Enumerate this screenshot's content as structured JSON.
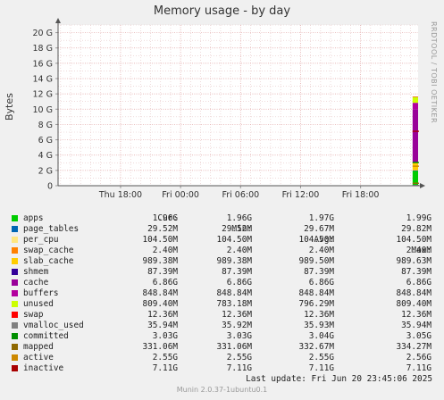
{
  "title": "Memory usage - by day",
  "side_text": "RRDTOOL / TOBI OETIKER",
  "last_update": "Last update: Fri Jun 20 23:45:06 2025",
  "footer": "Munin 2.0.37-1ubuntu0.1",
  "legend_headers": {
    "cur": "Cur:",
    "min": "Min:",
    "avg": "Avg:",
    "max": "Max:"
  },
  "legend": [
    {
      "name": "apps",
      "color": "#00cc00",
      "cur": "1.96G",
      "min": "1.96G",
      "avg": "1.97G",
      "max": "1.99G"
    },
    {
      "name": "page_tables",
      "color": "#0066b3",
      "cur": "29.52M",
      "min": "29.52M",
      "avg": "29.67M",
      "max": "29.82M"
    },
    {
      "name": "per_cpu",
      "color": "#ffe680",
      "cur": "104.50M",
      "min": "104.50M",
      "avg": "104.50M",
      "max": "104.50M"
    },
    {
      "name": "swap_cache",
      "color": "#ff8000",
      "cur": "2.40M",
      "min": "2.40M",
      "avg": "2.40M",
      "max": "2.40M"
    },
    {
      "name": "slab_cache",
      "color": "#ffcc00",
      "cur": "989.38M",
      "min": "989.38M",
      "avg": "989.50M",
      "max": "989.63M"
    },
    {
      "name": "shmem",
      "color": "#330099",
      "cur": "87.39M",
      "min": "87.39M",
      "avg": "87.39M",
      "max": "87.39M"
    },
    {
      "name": "cache",
      "color": "#990099",
      "cur": "6.86G",
      "min": "6.86G",
      "avg": "6.86G",
      "max": "6.86G"
    },
    {
      "name": "buffers",
      "color": "#b3009e",
      "cur": "848.84M",
      "min": "848.84M",
      "avg": "848.84M",
      "max": "848.84M"
    },
    {
      "name": "unused",
      "color": "#ccff00",
      "cur": "809.40M",
      "min": "783.18M",
      "avg": "796.29M",
      "max": "809.40M"
    },
    {
      "name": "swap",
      "color": "#ff0000",
      "cur": "12.36M",
      "min": "12.36M",
      "avg": "12.36M",
      "max": "12.36M"
    },
    {
      "name": "vmalloc_used",
      "color": "#808080",
      "cur": "35.94M",
      "min": "35.92M",
      "avg": "35.93M",
      "max": "35.94M"
    },
    {
      "name": "committed",
      "color": "#008f00",
      "cur": "3.03G",
      "min": "3.03G",
      "avg": "3.04G",
      "max": "3.05G"
    },
    {
      "name": "mapped",
      "color": "#8f6900",
      "cur": "331.06M",
      "min": "331.06M",
      "avg": "332.67M",
      "max": "334.27M"
    },
    {
      "name": "active",
      "color": "#cc8800",
      "cur": "2.55G",
      "min": "2.55G",
      "avg": "2.55G",
      "max": "2.56G"
    },
    {
      "name": "inactive",
      "color": "#a80000",
      "cur": "7.11G",
      "min": "7.11G",
      "avg": "7.11G",
      "max": "7.11G"
    }
  ],
  "chart_data": {
    "type": "area",
    "title": "Memory usage - by day",
    "ylabel": "Bytes",
    "ylim": [
      0,
      21
    ],
    "y_ticks": [
      "0",
      "2 G",
      "4 G",
      "6 G",
      "8 G",
      "10 G",
      "12 G",
      "14 G",
      "16 G",
      "18 G",
      "20 G"
    ],
    "y_tick_values": [
      0,
      2,
      4,
      6,
      8,
      10,
      12,
      14,
      16,
      18,
      20
    ],
    "x_ticks": [
      "Thu 18:00",
      "Fri 00:00",
      "Fri 06:00",
      "Fri 12:00",
      "Fri 18:00"
    ],
    "x_tick_hours": [
      18,
      24,
      30,
      36,
      42
    ],
    "xlim_hours": [
      11.75,
      47.75
    ],
    "grid": true,
    "data_window_hours": [
      47.2,
      47.75
    ],
    "stack_gb_order": [
      "apps",
      "page_tables",
      "per_cpu",
      "swap_cache",
      "slab_cache",
      "shmem",
      "cache",
      "buffers",
      "unused",
      "swap"
    ],
    "stack_gb": [
      1.96,
      0.029,
      0.102,
      0.002,
      0.966,
      0.085,
      6.86,
      0.829,
      0.79,
      0.012
    ],
    "line_series_gb": {
      "vmalloc_used": 0.035,
      "committed": 3.03,
      "mapped": 0.323,
      "active": 2.55,
      "inactive": 7.11
    }
  }
}
